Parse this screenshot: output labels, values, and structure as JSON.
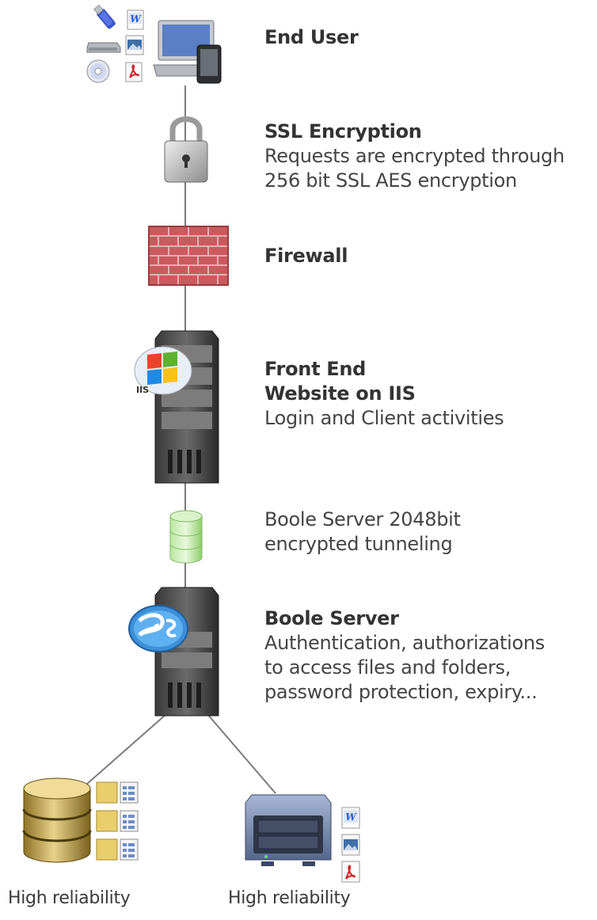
{
  "stages": {
    "end_user": {
      "title": "End User"
    },
    "ssl": {
      "title": "SSL Encryption",
      "lines": [
        "Requests are encrypted through",
        "256 bit SSL AES encryption"
      ]
    },
    "firewall": {
      "title": "Firewall"
    },
    "front_end": {
      "title_lines": [
        "Front End",
        "Website on IIS"
      ],
      "desc": "Login and Client activities"
    },
    "tunnel": {
      "lines": [
        "Boole Server 2048bit",
        "encrypted tunneling"
      ]
    },
    "boole_server": {
      "title": "Boole Server",
      "lines": [
        "Authentication, authorizations",
        "to access files and folders,",
        "password protection, expiry..."
      ]
    }
  },
  "storage": [
    {
      "caption": "High reliability",
      "icon": "database-icon"
    },
    {
      "caption": "High reliability",
      "icon": "nas-storage-icon"
    }
  ],
  "badges": {
    "iis": "IIS"
  },
  "colors": {
    "connector": "#777777",
    "firewall_brick": "#b5464a",
    "tunnel_green": "#9dd67a",
    "server_dark": "#2e2e2e",
    "db_gold": "#c8a84b",
    "nas_blue": "#6d7fa3"
  }
}
